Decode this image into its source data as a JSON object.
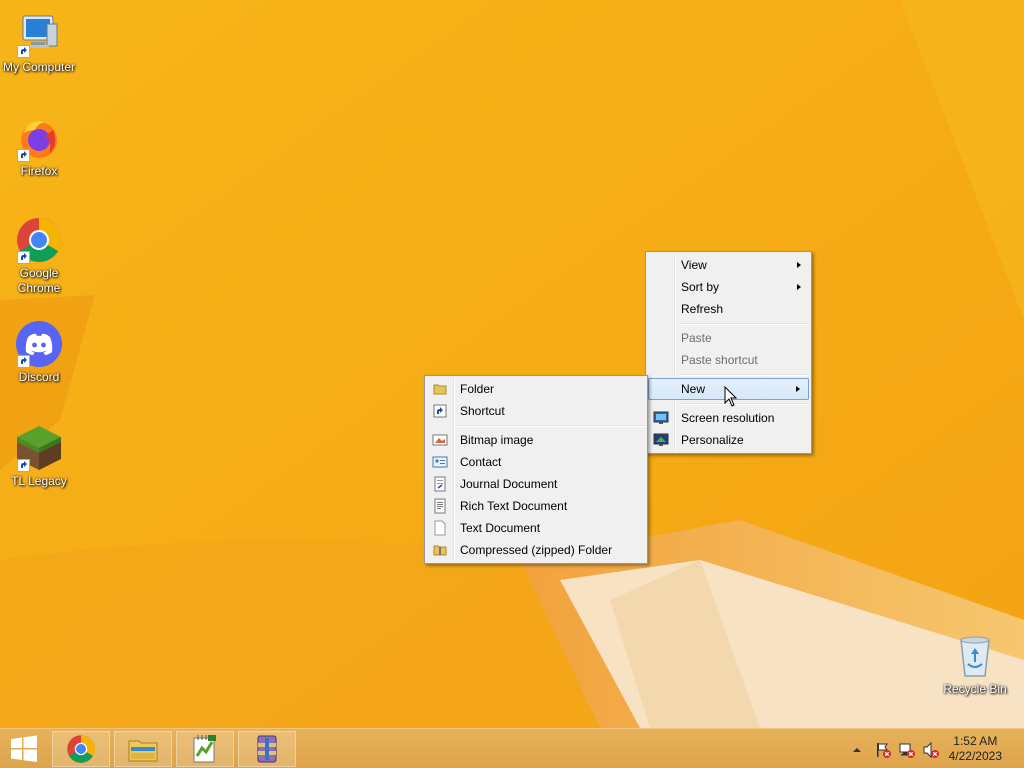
{
  "desktop": {
    "accent": "#f5ad16",
    "icons": [
      {
        "label": "My Computer",
        "icon": "computer-icon"
      },
      {
        "label": "Firefox",
        "icon": "firefox-icon"
      },
      {
        "label": "Google Chrome",
        "icon": "chrome-icon"
      },
      {
        "label": "Discord",
        "icon": "discord-icon"
      },
      {
        "label": "TL Legacy",
        "icon": "minecraft-grass-block-icon"
      },
      {
        "label": "Recycle Bin",
        "icon": "recycle-bin-icon"
      }
    ]
  },
  "context_menu": {
    "items": [
      {
        "label": "View",
        "submenu": true
      },
      {
        "label": "Sort by",
        "submenu": true
      },
      {
        "label": "Refresh"
      },
      {
        "label": "Paste",
        "disabled": true
      },
      {
        "label": "Paste shortcut",
        "disabled": true
      },
      {
        "label": "New",
        "submenu": true,
        "highlighted": true
      },
      {
        "label": "Screen resolution",
        "icon": "screen-resolution-icon"
      },
      {
        "label": "Personalize",
        "icon": "personalize-icon"
      }
    ]
  },
  "new_submenu": {
    "items": [
      {
        "label": "Folder",
        "icon": "folder-icon"
      },
      {
        "label": "Shortcut",
        "icon": "shortcut-icon"
      },
      {
        "label": "Bitmap image",
        "icon": "bitmap-icon"
      },
      {
        "label": "Contact",
        "icon": "contact-icon"
      },
      {
        "label": "Journal Document",
        "icon": "journal-icon"
      },
      {
        "label": "Rich Text Document",
        "icon": "rich-text-icon"
      },
      {
        "label": "Text Document",
        "icon": "text-document-icon"
      },
      {
        "label": "Compressed (zipped) Folder",
        "icon": "zip-folder-icon"
      }
    ]
  },
  "taskbar": {
    "apps": [
      "chrome-icon",
      "file-explorer-icon",
      "notepad-plus-plus-icon",
      "winrar-icon"
    ],
    "tray_icons": [
      "show-hidden-icons-icon",
      "action-center-flag-icon",
      "network-icon",
      "volume-muted-icon"
    ],
    "time": "1:52 AM",
    "date": "4/22/2023"
  }
}
